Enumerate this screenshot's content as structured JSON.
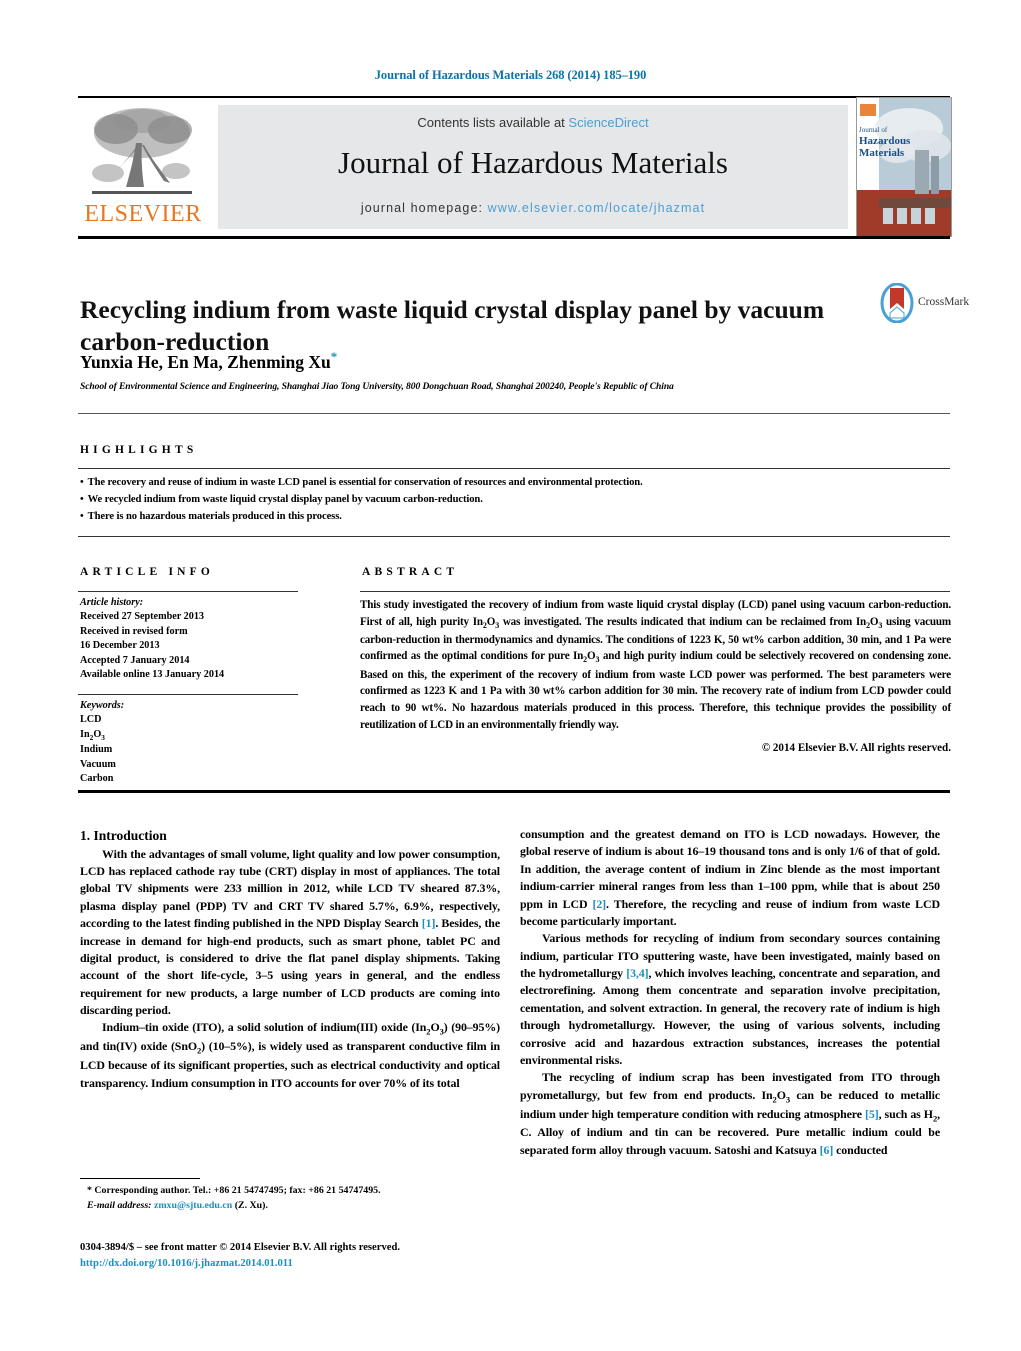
{
  "running_head": "Journal of Hazardous Materials 268 (2014) 185–190",
  "masthead": {
    "contents_text": "Contents lists available at ",
    "sciencedirect": "ScienceDirect",
    "journal_title": "Journal of Hazardous Materials",
    "homepage_label": "journal homepage: ",
    "homepage_url": "www.elsevier.com/locate/jhazmat",
    "publisher": "ELSEVIER",
    "cover_title_line1": "Journal of",
    "cover_title_line2": "Hazardous",
    "cover_title_line3": "Materials"
  },
  "article": {
    "title": "Recycling indium from waste liquid crystal display panel by vacuum carbon-reduction",
    "authors": "Yunxia He, En Ma, Zhenming Xu",
    "corresponding_marker": "*",
    "affiliation": "School of Environmental Science and Engineering, Shanghai Jiao Tong University, 800 Dongchuan Road, Shanghai 200240, People's Republic of China",
    "crossmark_label": "CrossMark"
  },
  "highlights": {
    "label": "HIGHLIGHTS",
    "items": [
      "The recovery and reuse of indium in waste LCD panel is essential for conservation of resources and environmental protection.",
      "We recycled indium from waste liquid crystal display panel by vacuum carbon-reduction.",
      "There is no hazardous materials produced in this process."
    ]
  },
  "article_info": {
    "label": "ARTICLE INFO",
    "history_heading": "Article history:",
    "history": [
      "Received 27 September 2013",
      "Received in revised form",
      "16 December 2013",
      "Accepted 7 January 2014",
      "Available online 13 January 2014"
    ],
    "keywords_heading": "Keywords:",
    "keywords": [
      "LCD",
      "In2O3",
      "Indium",
      "Vacuum",
      "Carbon"
    ]
  },
  "abstract": {
    "label": "ABSTRACT",
    "text": "This study investigated the recovery of indium from waste liquid crystal display (LCD) panel using vacuum carbon-reduction. First of all, high purity In2O3 was investigated. The results indicated that indium can be reclaimed from In2O3 using vacuum carbon-reduction in thermodynamics and dynamics. The conditions of 1223 K, 50 wt% carbon addition, 30 min, and 1 Pa were confirmed as the optimal conditions for pure In2O3 and high purity indium could be selectively recovered on condensing zone. Based on this, the experiment of the recovery of indium from waste LCD power was performed. The best parameters were confirmed as 1223 K and 1 Pa with 30 wt% carbon addition for 30 min. The recovery rate of indium from LCD powder could reach to 90 wt%. No hazardous materials produced in this process. Therefore, this technique provides the possibility of reutilization of LCD in an environmentally friendly way.",
    "copyright": "© 2014 Elsevier B.V. All rights reserved."
  },
  "body": {
    "section_heading": "1. Introduction",
    "left_paragraphs": [
      "With the advantages of small volume, light quality and low power consumption, LCD has replaced cathode ray tube (CRT) display in most of appliances. The total global TV shipments were 233 million in 2012, while LCD TV sheared 87.3%, plasma display panel (PDP) TV and CRT TV shared 5.7%, 6.9%, respectively, according to the latest finding published in the NPD Display Search [1]. Besides, the increase in demand for high-end products, such as smart phone, tablet PC and digital product, is considered to drive the flat panel display shipments. Taking account of the short life-cycle, 3–5 using years in general, and the endless requirement for new products, a large number of LCD products are coming into discarding period.",
      "Indium–tin oxide (ITO), a solid solution of indium(III) oxide (In2O3) (90–95%) and tin(IV) oxide (SnO2) (10–5%), is widely used as transparent conductive film in LCD because of its significant properties, such as electrical conductivity and optical transparency. Indium consumption in ITO accounts for over 70% of its total"
    ],
    "right_paragraphs": [
      "consumption and the greatest demand on ITO is LCD nowadays. However, the global reserve of indium is about 16–19 thousand tons and is only 1/6 of that of gold. In addition, the average content of indium in Zinc blende as the most important indium-carrier mineral ranges from less than 1–100 ppm, while that is about 250 ppm in LCD [2]. Therefore, the recycling and reuse of indium from waste LCD become particularly important.",
      "Various methods for recycling of indium from secondary sources containing indium, particular ITO sputtering waste, have been investigated, mainly based on the hydrometallurgy [3,4], which involves leaching, concentrate and separation, and electrorefining. Among them concentrate and separation involve precipitation, cementation, and solvent extraction. In general, the recovery rate of indium is high through hydrometallurgy. However, the using of various solvents, including corrosive acid and hazardous extraction substances, increases the potential environmental risks.",
      "The recycling of indium scrap has been investigated from ITO through pyrometallurgy, but few from end products. In2O3 can be reduced to metallic indium under high temperature condition with reducing atmosphere [5], such as H2, C. Alloy of indium and tin can be recovered. Pure metallic indium could be separated form alloy through vacuum. Satoshi and Katsuya [6] conducted"
    ]
  },
  "footer": {
    "corresponding_text": "* Corresponding author. Tel.: +86 21 54747495; fax: +86 21 54747495.",
    "email_label": "E-mail address:",
    "email": "zmxu@sjtu.edu.cn",
    "email_suffix": "(Z. Xu).",
    "imprint": "0304-3894/$ – see front matter © 2014 Elsevier B.V. All rights reserved.",
    "doi": "http://dx.doi.org/10.1016/j.jhazmat.2014.01.011"
  },
  "colors": {
    "link_blue": "#1a8fc1",
    "sd_blue": "#4a9fd4",
    "elsevier_orange": "#E87722",
    "header_blue": "#0b74a8"
  }
}
